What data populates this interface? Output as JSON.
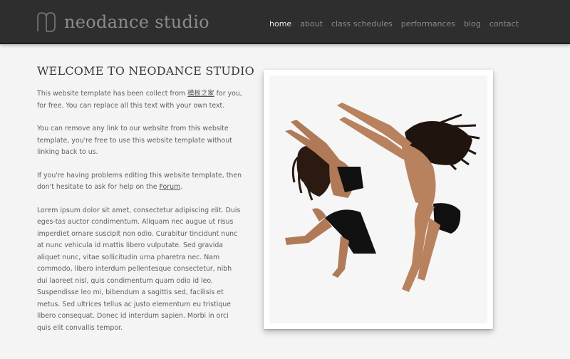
{
  "site": {
    "name": "neodance studio"
  },
  "nav": {
    "items": [
      {
        "label": "home",
        "active": true
      },
      {
        "label": "about",
        "active": false
      },
      {
        "label": "class schedules",
        "active": false
      },
      {
        "label": "performances",
        "active": false
      },
      {
        "label": "blog",
        "active": false
      },
      {
        "label": "contact",
        "active": false
      }
    ]
  },
  "main": {
    "title": "WELCOME TO NEODANCE STUDIO",
    "p1_pre": "This website template has been collect from ",
    "p1_link": "模板之家",
    "p1_post": " for you, for free. You can replace all this text with your own text.",
    "p2": "You can remove any link to our website from this website template, you're free to use this website template without linking back to us.",
    "p3_pre": "If you're having problems editing this website template, then don't hesitate to ask for help on the ",
    "p3_link": "Forum",
    "p3_post": ".",
    "p4": "Lorem ipsum dolor sit amet, consectetur adipiscing elit. Duis eges-tas auctor condimentum. Aliquam nec augue ut risus imperdiet ornare suscipit non odio. Curabitur tincidunt nunc at nunc vehicula id mattis libero vulputate. Sed gravida aliquet nunc, vitae sollicitudin urna pharetra nec. Nam commodo, libero interdum pellentesque consectetur, nibh dui laoreet nisl, quis condimentum quam odio id leo. Suspendisse leo mi, bibendum a sagittis sed, facilisis et metus. Sed ultrices tellus ac justo elementum eu tristique libero consequat. Donec id interdum sapien. Morbi in orci quis elit convallis tempor."
  },
  "colors": {
    "header_bg": "#2e2e2e",
    "page_bg": "#f4f4f4",
    "nav_active": "#e8e8e8",
    "nav_inactive": "#8a8a8a"
  }
}
